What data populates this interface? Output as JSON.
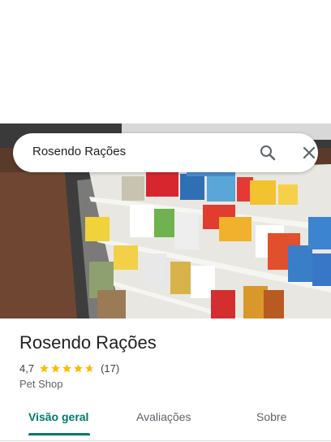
{
  "search": {
    "query": "Rosendo Rações",
    "search_icon": "search-icon",
    "close_icon": "close-icon"
  },
  "place": {
    "name": "Rosendo Rações",
    "rating": "4,7",
    "stars": 4.7,
    "review_count": "(17)",
    "category": "Pet Shop"
  },
  "tabs": [
    {
      "label": "Visão geral",
      "active": true
    },
    {
      "label": "Avaliações",
      "active": false
    },
    {
      "label": "Sobre",
      "active": false
    }
  ],
  "colors": {
    "accent": "#00796b",
    "star": "#fbbc04",
    "star_empty": "#dadce0"
  }
}
